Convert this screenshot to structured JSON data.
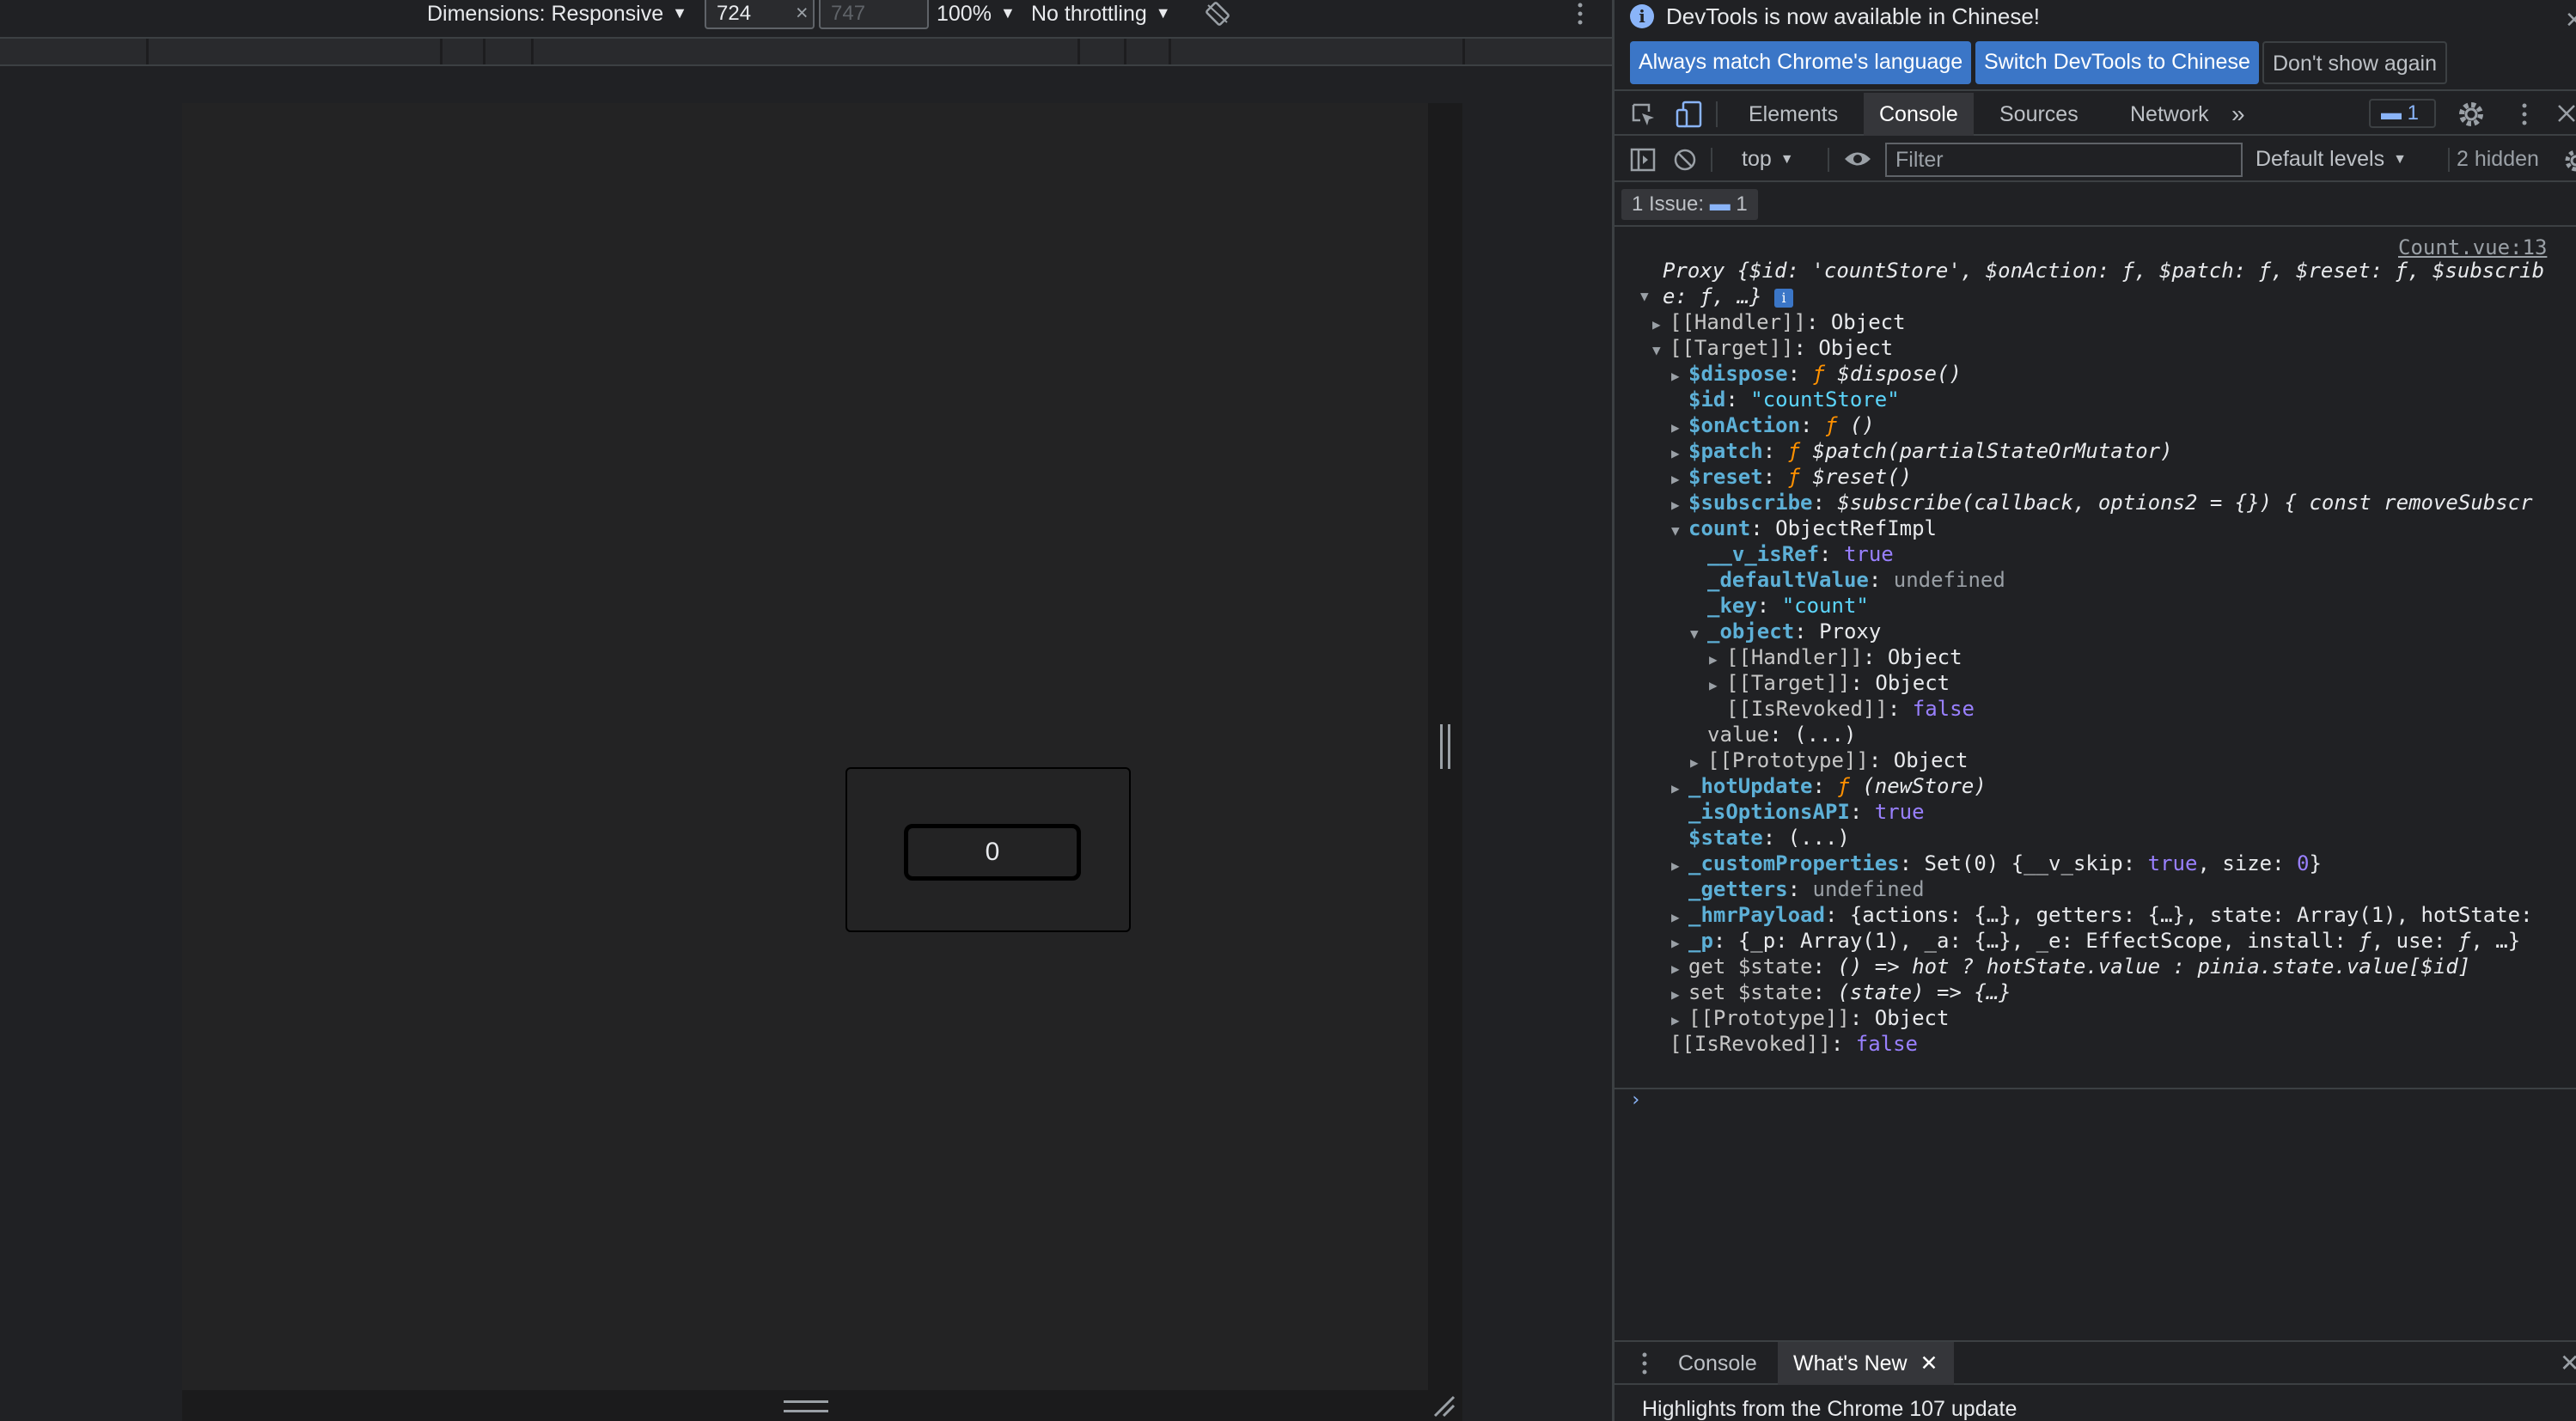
{
  "device_toolbar": {
    "dimensions_label": "Dimensions: Responsive",
    "width": "724",
    "height": "747",
    "times": "×",
    "zoom": "100%",
    "throttling": "No throttling",
    "caret": "▼"
  },
  "app": {
    "counter_value": "0"
  },
  "devtools": {
    "infobar": {
      "message": "DevTools is now available in Chinese!",
      "info_glyph": "i",
      "close": "✕",
      "btn_match": "Always match Chrome's language",
      "btn_switch": "Switch DevTools to Chinese",
      "btn_dismiss": "Don't show again"
    },
    "tabs": [
      "Elements",
      "Console",
      "Sources",
      "Network"
    ],
    "more_tabs": "»",
    "issue_count": "1",
    "console_toolbar": {
      "context": "top",
      "filter_placeholder": "Filter",
      "levels": "Default levels",
      "hidden": "2 hidden"
    },
    "issues_label": "1 Issue:",
    "issues_count": "1",
    "source_link": "Count.vue:13",
    "log": {
      "l0_a": "Proxy {",
      "l0_k1": "$id",
      "l0_v1": "'countStore'",
      "l0_k2": "$onAction",
      "l0_k3": "$patch",
      "l0_k4": "$reset",
      "l0_k5": "$subscrib",
      "l0_wrap": "e",
      "l0_end": "…}",
      "f": "ƒ",
      "handler": "[[Handler]]",
      "target": "[[Target]]",
      "object": "Object",
      "dispose_k": "$dispose",
      "dispose_v": "$dispose()",
      "id_k": "$id",
      "id_v": "\"countStore\"",
      "onaction_k": "$onAction",
      "onaction_v": "()",
      "patch_k": "$patch",
      "patch_v": "$patch(partialStateOrMutator)",
      "reset_k": "$reset",
      "reset_v": "$reset()",
      "subscribe_k": "$subscribe",
      "subscribe_v": "$subscribe(callback, options2 = {}) { const removeSubscr",
      "count_k": "count",
      "count_v": "ObjectRefImpl",
      "isref_k": "__v_isRef",
      "true": "true",
      "false": "false",
      "undefined": "undefined",
      "defval_k": "_defaultValue",
      "key_k": "_key",
      "key_v": "\"count\"",
      "object_k": "_object",
      "proxy": "Proxy",
      "isrevoked": "[[IsRevoked]]",
      "value_k": "value",
      "ellipsis": "(...)",
      "prototype": "[[Prototype]]",
      "hotupdate_k": "_hotUpdate",
      "hotupdate_v": "(newStore)",
      "optionsapi_k": "_isOptionsAPI",
      "state_k": "$state",
      "customprops_k": "_customProperties",
      "customprops_v1": "Set(0) {__v_skip:",
      "customprops_v2": ", size:",
      "zero": "0",
      "customprops_end": "}",
      "getters_k": "_getters",
      "hmr_k": "_hmrPayload",
      "hmr_v": "{actions: {…}, getters: {…}, state: Array(1), hotState:",
      "p_k": "_p",
      "p_v1": "{_p: Array(1), _a: {…}, _e: EffectScope, install:",
      "p_v2": ", use:",
      "p_v3": ", …}",
      "getstate_pre": "get",
      "getstate_v": "() => hot ? hotState.value : pinia.state.value[$id]",
      "setstate_pre": "set",
      "setstate_v": "(state) => {…}",
      "prompt": "›"
    },
    "drawer": {
      "tab_console": "Console",
      "tab_whats_new": "What's New",
      "tab_close": "✕",
      "close": "✕",
      "highlights": "Highlights from the Chrome 107 update"
    }
  }
}
